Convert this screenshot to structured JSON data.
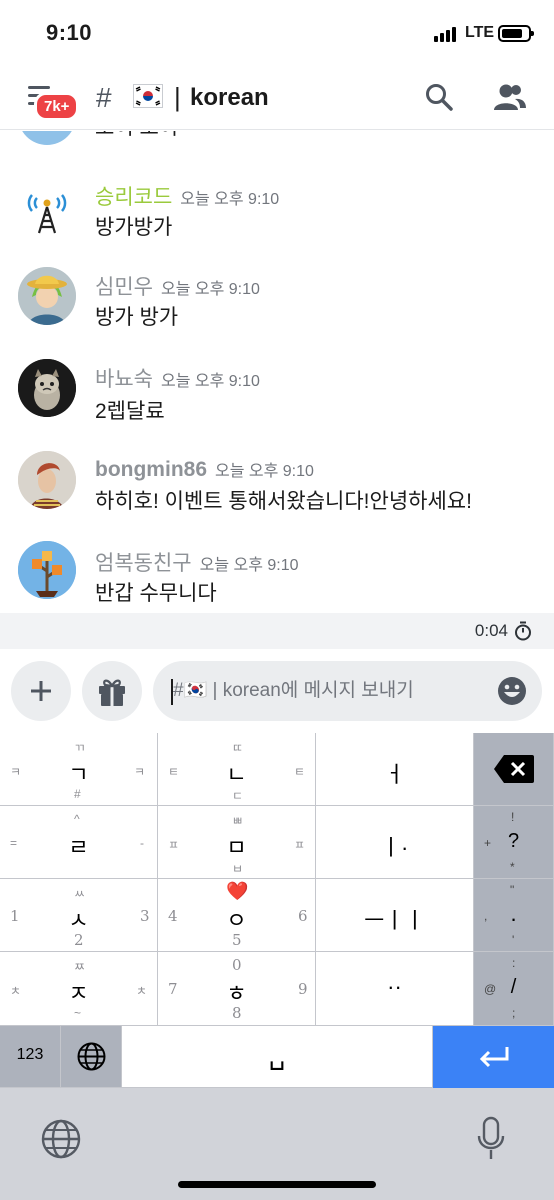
{
  "status_bar": {
    "time": "9:10",
    "network": "LTE"
  },
  "header": {
    "mention_count": "7k+",
    "hash": "#",
    "separator": "|",
    "channel_name": "korean"
  },
  "messages": [
    {
      "author": "",
      "timestamp": "",
      "text": "오이 오이",
      "author_color": "#72767d"
    },
    {
      "author": "승리코드",
      "timestamp": "오늘 오후 9:10",
      "text": "방가방가",
      "author_color": "#9aca3c"
    },
    {
      "author": "심민우",
      "timestamp": "오늘 오후 9:10",
      "text": "방가 방가",
      "author_color": "#8e9297"
    },
    {
      "author": "바뇨숙",
      "timestamp": "오늘 오후 9:10",
      "text": "2렙달료",
      "author_color": "#8e9297"
    },
    {
      "author": "bongmin86",
      "timestamp": "오늘 오후 9:10",
      "text": "하히호! 이벤트 통해서왔습니다!안녕하세요!",
      "author_color": "#8e9297"
    },
    {
      "author": "엄복동친구",
      "timestamp": "오늘 오후 9:10",
      "text": "반갑 수무니다",
      "author_color": "#8e9297"
    }
  ],
  "upload": {
    "elapsed": "0:04"
  },
  "composer": {
    "placeholder": "#🇰🇷 | korean에 메시지 보내기"
  },
  "keyboard": {
    "rows": [
      [
        {
          "main": "ㄱ",
          "top": "ㄲ",
          "left": "ㅋ",
          "right": "ㅋ",
          "bottom": "#"
        },
        {
          "main": "ㄴ",
          "top": "ㄸ",
          "left": "ㅌ",
          "right": "ㅌ",
          "bottom": "ㄷ"
        },
        {
          "main": "ㅓ"
        }
      ],
      [
        {
          "main": "ㄹ",
          "top": "^",
          "left": "=",
          "right": "-",
          "bottom": ""
        },
        {
          "main": "ㅁ",
          "top": "ㅃ",
          "left": "ㅍ",
          "right": "ㅍ",
          "bottom": "ㅂ"
        },
        {
          "main": "ㅣ·"
        }
      ],
      [
        {
          "main": "ㅅ",
          "top": "ㅆ",
          "left": "1",
          "right": "3",
          "bottom": "2"
        },
        {
          "main": "ㅇ",
          "top": "❤️",
          "left": "4",
          "right": "6",
          "bottom": "5"
        },
        {
          "main": "ㅡㅣㅣ"
        }
      ],
      [
        {
          "main": "ㅈ",
          "top": "ㅉ",
          "left": "ㅊ",
          "right": "ㅊ",
          "bottom": "~"
        },
        {
          "main": "ㅎ",
          "top": "0",
          "left": "7",
          "right": "9",
          "bottom": "8"
        },
        {
          "main": "··"
        }
      ]
    ],
    "side_keys": [
      {
        "main": "",
        "top": "",
        "left": "",
        "bottom": ""
      },
      {
        "main": "?",
        "top": "!",
        "left": "+",
        "bottom": "*"
      },
      {
        "main": ".",
        "top": "\"",
        "left": ",",
        "bottom": "'"
      },
      {
        "main": "/",
        "top": ":",
        "left": "@",
        "bottom": ";"
      }
    ],
    "numbers_label": "123",
    "space_label": "␣"
  },
  "colors": {
    "accent": "#3b82f6",
    "badge": "#ed4245",
    "keyboard_bg": "#d1d3d9",
    "key_dark": "#adb2bc"
  }
}
